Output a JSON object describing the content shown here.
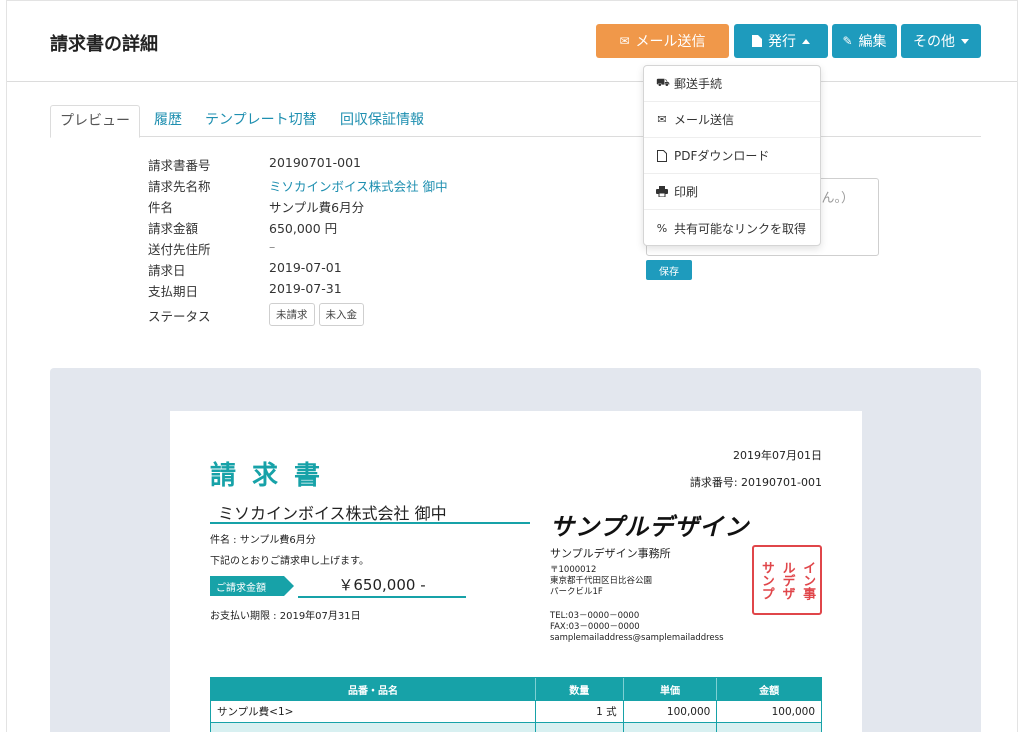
{
  "page": {
    "title": "請求書の詳細"
  },
  "toolbar": {
    "mail_label": "メール送信",
    "issue_label": "発行",
    "edit_label": "編集",
    "other_label": "その他"
  },
  "dropdown": {
    "items": [
      {
        "icon": "truck-icon",
        "label": "郵送手続"
      },
      {
        "icon": "envelope-icon",
        "label": "メール送信"
      },
      {
        "icon": "pdf-icon",
        "label": "PDFダウンロード"
      },
      {
        "icon": "print-icon",
        "label": "印刷"
      },
      {
        "icon": "link-icon",
        "label": "共有可能なリンクを取得"
      }
    ]
  },
  "tabs": [
    {
      "label": "プレビュー"
    },
    {
      "label": "履歴"
    },
    {
      "label": "テンプレート切替"
    },
    {
      "label": "回収保証情報"
    }
  ],
  "info": {
    "rows": [
      {
        "label": "請求書番号",
        "value": "20190701-001"
      },
      {
        "label": "請求先名称",
        "value": "ミソカインボイス株式会社 御中"
      },
      {
        "label": "件名",
        "value": "サンプル費6月分"
      },
      {
        "label": "請求金額",
        "value": "650,000 円"
      },
      {
        "label": "送付先住所",
        "value": "–"
      },
      {
        "label": "請求日",
        "value": "2019-07-01"
      },
      {
        "label": "支払期日",
        "value": "2019-07-31"
      }
    ],
    "status_label": "ステータス",
    "status_badges": [
      "未請求",
      "未入金"
    ]
  },
  "memo": {
    "placeholder_fragment": "ん。）",
    "save_label": "保存"
  },
  "invoice": {
    "date": "2019年07月01日",
    "number": "請求番号: 20190701-001",
    "title": "請求書",
    "client": "ミソカインボイス株式会社 御中",
    "subject": "件名 : サンプル費6月分",
    "greeting": "下記のとおりご請求申し上げます。",
    "amount_label": "ご請求金額",
    "amount": "￥650,000 -",
    "due": "お支払い期限 : 2019年07月31日",
    "company_logo": "サンプルデザイン",
    "company_name": "サンプルデザイン事務所",
    "postal": "〒1000012",
    "address1": "東京都千代田区日比谷公園",
    "address2": "パークビル1F",
    "tel": "TEL:03－0000－0000",
    "fax": "FAX:03－0000－0000",
    "email": "samplemailaddress@samplemailaddress",
    "seal_text": [
      "サンプ",
      "ルデザ",
      "イン事",
      "務所"
    ],
    "table": {
      "headers": [
        "品番・品名",
        "数量",
        "単価",
        "金額"
      ],
      "rows": [
        {
          "name": "サンプル費<1>",
          "qty": "1 式",
          "unit": "100,000",
          "amount": "100,000"
        }
      ]
    }
  },
  "colors": {
    "accent": "#1e9bbd",
    "mail": "#f0984a",
    "invoice_teal": "#17a2a8",
    "seal_red": "#e0464a"
  }
}
